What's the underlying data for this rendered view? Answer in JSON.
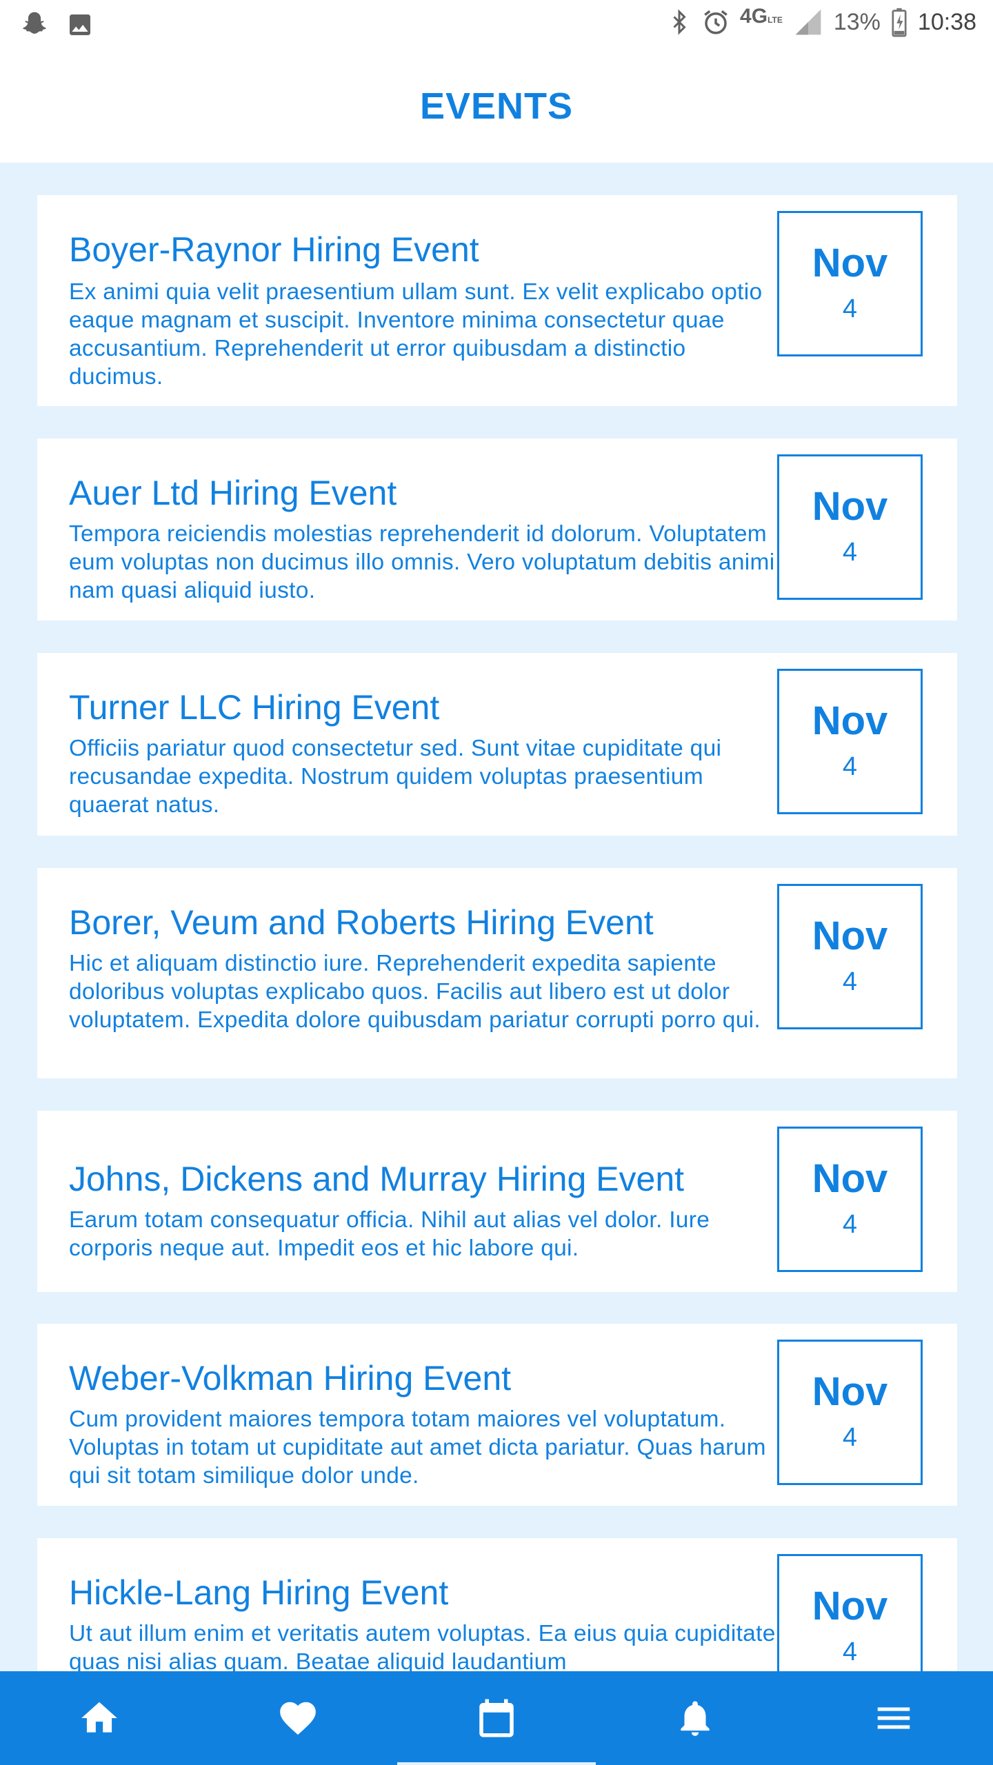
{
  "status_bar": {
    "left_icons": [
      "snapchat-icon",
      "image-icon"
    ],
    "right_icons": [
      "bluetooth-icon",
      "alarm-icon",
      "network-4g-lte-icon",
      "signal-icon",
      "battery-charging-icon"
    ],
    "network": "4G",
    "battery": "13%",
    "time": "10:38"
  },
  "header": {
    "title": "EVENTS"
  },
  "colors": {
    "accent": "#1181e0",
    "list_background": "#e3f2fd",
    "card_background": "#ffffff"
  },
  "events": [
    {
      "title": "Boyer-Raynor Hiring Event",
      "description": "Ex animi quia velit praesentium ullam sunt. Ex velit explicabo optio eaque magnam et suscipit. Inventore minima consectetur quae accusantium. Reprehenderit ut error quibusdam a distinctio ducimus.",
      "month": "Nov",
      "day": "4"
    },
    {
      "title": "Auer Ltd Hiring Event",
      "description": "Tempora reiciendis molestias reprehenderit id dolorum. Voluptatem eum voluptas non ducimus illo omnis. Vero voluptatum debitis animi nam quasi aliquid iusto.",
      "month": "Nov",
      "day": "4"
    },
    {
      "title": "Turner LLC Hiring Event",
      "description": "Officiis pariatur quod consectetur sed. Sunt vitae cupiditate qui recusandae expedita. Nostrum quidem voluptas praesentium quaerat natus.",
      "month": "Nov",
      "day": "4"
    },
    {
      "title": "Borer, Veum and Roberts Hiring Event",
      "description": "Hic et aliquam distinctio iure. Reprehenderit expedita sapiente doloribus voluptas explicabo quos. Facilis aut libero est ut dolor voluptatem. Expedita dolore quibusdam pariatur corrupti porro qui.",
      "month": "Nov",
      "day": "4"
    },
    {
      "title": "Johns, Dickens and Murray Hiring Event",
      "description": "Earum totam consequatur officia. Nihil aut alias vel dolor. Iure corporis neque aut. Impedit eos et hic labore qui.",
      "month": "Nov",
      "day": "4"
    },
    {
      "title": "Weber-Volkman Hiring Event",
      "description": "Cum provident maiores tempora totam maiores vel voluptatum. Voluptas in totam ut cupiditate aut amet dicta pariatur. Quas harum qui sit totam similique dolor unde.",
      "month": "Nov",
      "day": "4"
    },
    {
      "title": "Hickle-Lang Hiring Event",
      "description": "Ut aut illum enim et veritatis autem voluptas. Ea eius quia cupiditate quas nisi alias quam. Beatae aliquid laudantium",
      "month": "Nov",
      "day": "4"
    }
  ],
  "bottom_nav": {
    "items": [
      {
        "icon": "home-icon"
      },
      {
        "icon": "heart-icon"
      },
      {
        "icon": "calendar-icon",
        "selected": true
      },
      {
        "icon": "bell-icon"
      },
      {
        "icon": "menu-icon"
      }
    ]
  }
}
